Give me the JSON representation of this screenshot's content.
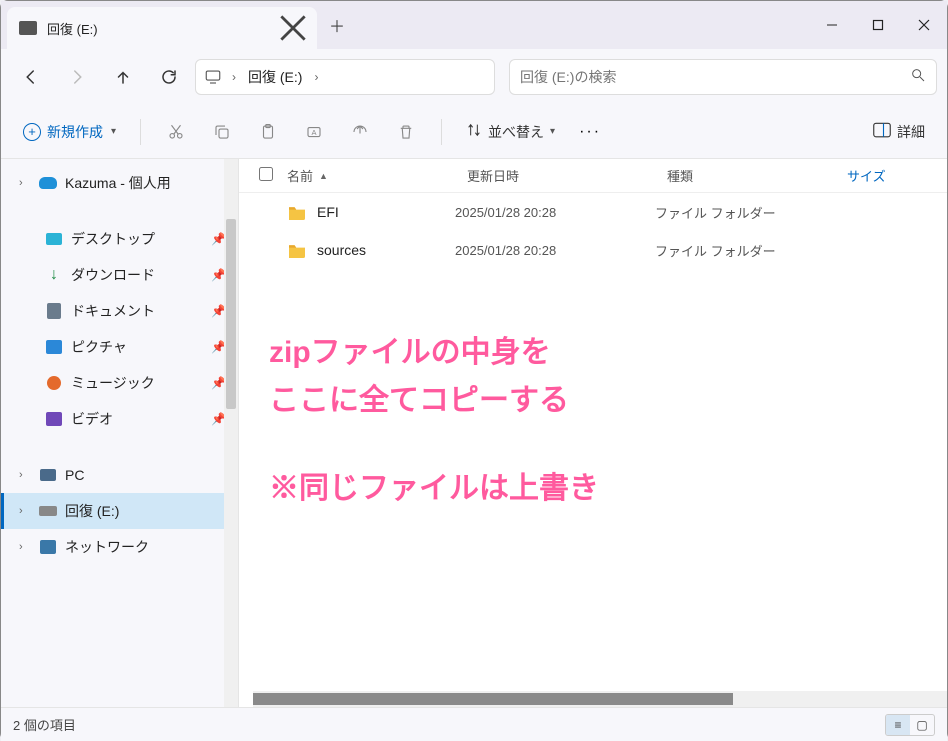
{
  "tab": {
    "title": "回復 (E:)"
  },
  "breadcrumb": {
    "current": "回復 (E:)"
  },
  "search": {
    "placeholder": "回復 (E:)の検索"
  },
  "commands": {
    "new": "新規作成",
    "sort": "並べ替え",
    "detail": "詳細"
  },
  "columns": {
    "name": "名前",
    "date": "更新日時",
    "type": "種類",
    "size": "サイズ"
  },
  "files": [
    {
      "name": "EFI",
      "date": "2025/01/28 20:28",
      "type": "ファイル フォルダー"
    },
    {
      "name": "sources",
      "date": "2025/01/28 20:28",
      "type": "ファイル フォルダー"
    }
  ],
  "sidebar": {
    "onedrive": "Kazuma - 個人用",
    "quick": [
      {
        "label": "デスクトップ"
      },
      {
        "label": "ダウンロード"
      },
      {
        "label": "ドキュメント"
      },
      {
        "label": "ピクチャ"
      },
      {
        "label": "ミュージック"
      },
      {
        "label": "ビデオ"
      }
    ],
    "pc": "PC",
    "recovery": "回復 (E:)",
    "network": "ネットワーク"
  },
  "overlay": {
    "line1": "zipファイルの中身を",
    "line2": "ここに全てコピーする",
    "line3": "※同じファイルは上書き"
  },
  "status": {
    "count": "2 個の項目"
  }
}
